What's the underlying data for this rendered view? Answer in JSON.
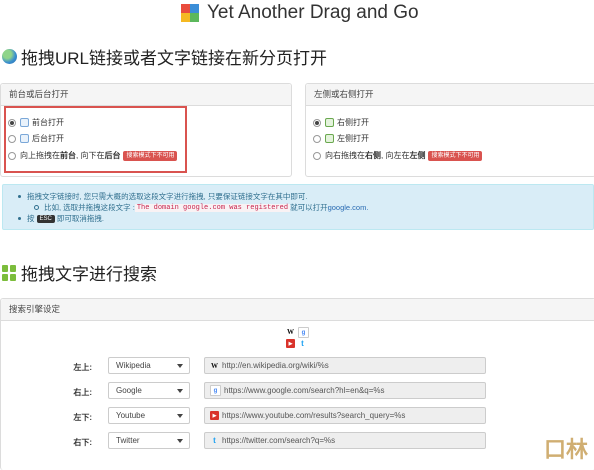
{
  "app": {
    "title": "Yet Another Drag and Go"
  },
  "sections": {
    "drag_link": "拖拽URL链接或者文字链接在新分页打开",
    "drag_text": "拖拽文字进行搜索"
  },
  "front_back_panel": {
    "header": "前台或后台打开",
    "options": [
      {
        "label": "前台打开",
        "checked": true
      },
      {
        "label": "后台打开",
        "checked": false
      },
      {
        "label_prefix": "向上拖拽在",
        "label_bold1": "前台",
        "label_mid": ", 向下在",
        "label_bold2": "后台",
        "badge": "搜索模式下不可用",
        "checked": false
      }
    ]
  },
  "left_right_panel": {
    "header": "左侧或右侧打开",
    "options": [
      {
        "label": "右侧打开",
        "checked": true
      },
      {
        "label": "左侧打开",
        "checked": false
      },
      {
        "label_prefix": "向右拖拽在",
        "label_bold1": "右侧",
        "label_mid": ", 向左在",
        "label_bold2": "左侧",
        "badge": "搜索模式下不可用",
        "checked": false
      }
    ]
  },
  "info": {
    "line1": "拖拽文字链接时, 您只需大概的选取这段文字进行拖拽, 只要保证链接文字在其中即可.",
    "line2_prefix": "比如, 选取并拖拽这段文字 : ",
    "line2_code": "The domain google.com was registered",
    "line2_suffix": " 就可以打开 ",
    "line2_link": "google.com.",
    "line3_prefix": "按",
    "line3_key": "ESC",
    "line3_suffix": "即可取消拖拽."
  },
  "search_panel": {
    "header": "搜索引擎设定",
    "rows": [
      {
        "position": "左上:",
        "engine": "Wikipedia",
        "icon": "wikipedia-icon",
        "url": "http://en.wikipedia.org/wiki/%s"
      },
      {
        "position": "右上:",
        "engine": "Google",
        "icon": "google-icon",
        "url": "https://www.google.com/search?hl=en&q=%s"
      },
      {
        "position": "左下:",
        "engine": "Youtube",
        "icon": "youtube-icon",
        "url": "https://www.youtube.com/results?search_query=%s"
      },
      {
        "position": "右下:",
        "engine": "Twitter",
        "icon": "twitter-icon",
        "url": "https://twitter.com/search?q=%s"
      }
    ]
  },
  "watermark": "口林",
  "colors": {
    "accent_red": "#d9534f",
    "info_bg": "#d9edf7",
    "info_text": "#31708f",
    "link": "#2a6cb3"
  }
}
